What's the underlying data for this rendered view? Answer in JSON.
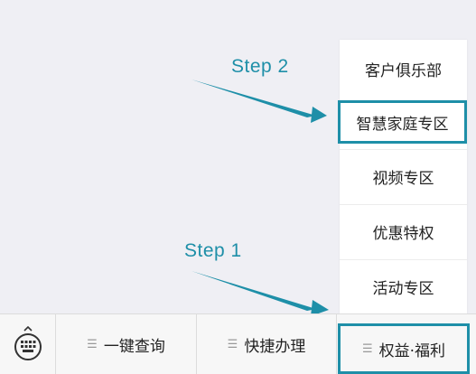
{
  "popup_menu": {
    "items": [
      {
        "label": "客户俱乐部"
      },
      {
        "label": "智慧家庭专区"
      },
      {
        "label": "视频专区"
      },
      {
        "label": "优惠特权"
      },
      {
        "label": "活动专区"
      }
    ]
  },
  "bottom_bar": {
    "keyboard_icon": "keyboard-icon",
    "tabs": [
      {
        "label": "一键查询"
      },
      {
        "label": "快捷办理"
      },
      {
        "label": "权益·福利"
      }
    ]
  },
  "annotations": {
    "step1": "Step 1",
    "step2": "Step 2"
  },
  "colors": {
    "highlight": "#1e8fa8",
    "background": "#efeff4"
  }
}
